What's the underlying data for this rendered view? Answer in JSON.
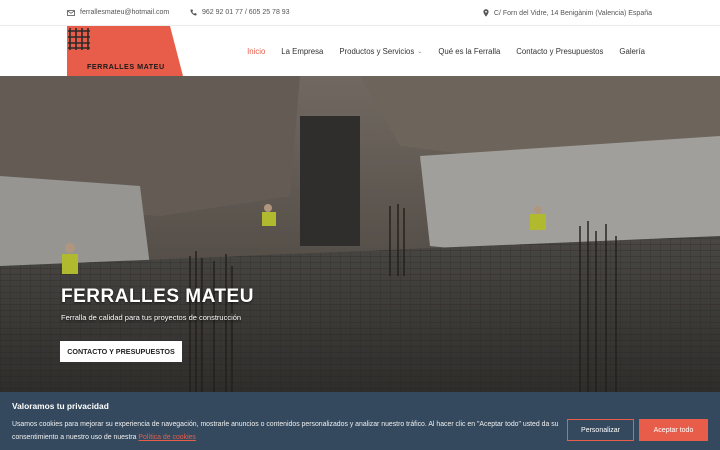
{
  "colors": {
    "accent": "#e85d4a",
    "cookie_bg": "#34495e",
    "logo_bg": "#e85d4a"
  },
  "topbar": {
    "email_icon": "envelope-icon",
    "email": "ferrallesmateu@hotmail.com",
    "phone_icon": "phone-icon",
    "phone": "962 92 01 77 / 605 25 78 93",
    "address_icon": "map-pin-icon",
    "address": "C/ Forn del Vidre, 14 Benigànim (Valencia) España"
  },
  "logo": {
    "text": "FERRALLES MATEU",
    "icon": "rebar-grid-icon"
  },
  "nav": {
    "items": [
      {
        "label": "Inicio",
        "active": true
      },
      {
        "label": "La Empresa"
      },
      {
        "label": "Productos y Servicios",
        "has_submenu": true
      },
      {
        "label": "Qué es la Ferralla"
      },
      {
        "label": "Contacto y Presupuestos"
      },
      {
        "label": "Galería"
      }
    ]
  },
  "hero": {
    "title": "FERRALLES MATEU",
    "subtitle": "Ferralla de calidad para tus proyectos de construcción",
    "cta_label": "CONTACTO Y PRESUPUESTOS"
  },
  "cookie": {
    "title": "Valoramos tu privacidad",
    "text": "Usamos cookies para mejorar su experiencia de navegación, mostrarle anuncios o contenidos personalizados y analizar nuestro tráfico. Al hacer clic en \"Aceptar todo\" usted da su consentimiento a nuestro uso de nuestra",
    "link_label": "Política de cookies",
    "customize_label": "Personalizar",
    "accept_label": "Aceptar todo"
  }
}
